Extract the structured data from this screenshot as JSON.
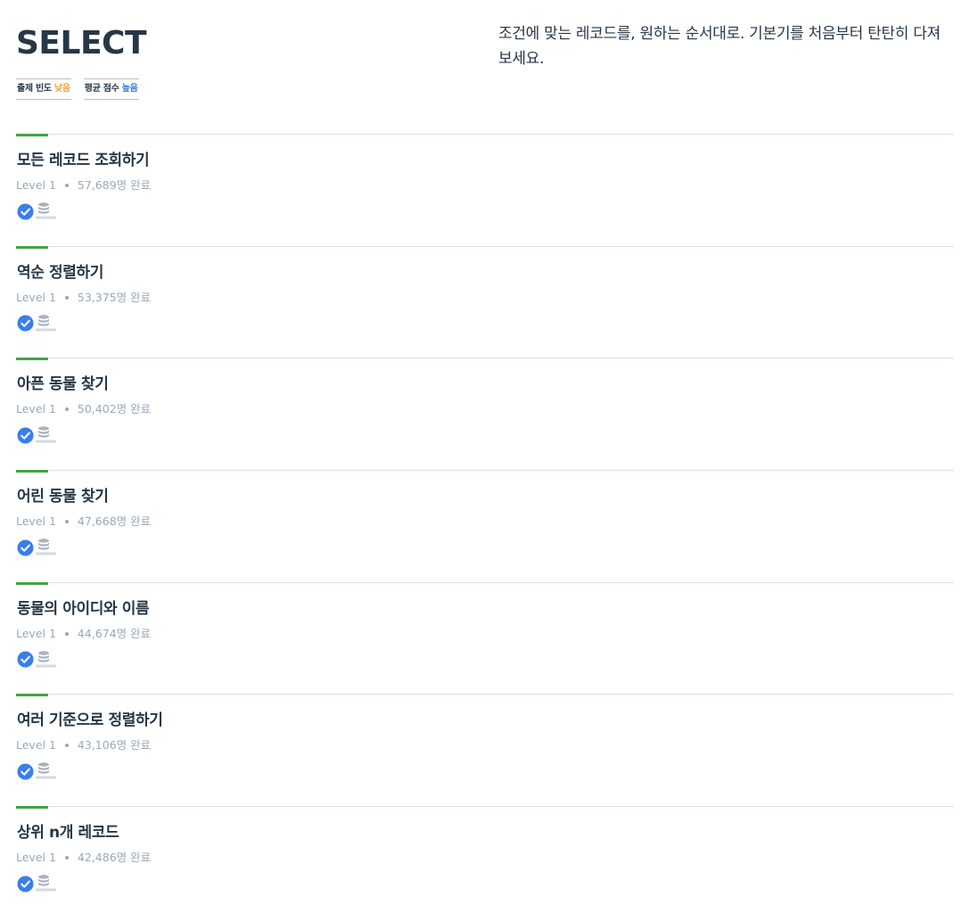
{
  "header": {
    "title": "SELECT",
    "tags": [
      {
        "label": "출제 빈도",
        "value": "낮음",
        "tone": "low"
      },
      {
        "label": "평균 점수",
        "value": "높음",
        "tone": "high"
      }
    ],
    "description": "조건에 맞는 레코드를, 원하는 순서대로. 기본기를 처음부터 탄탄히 다져보세요."
  },
  "colors": {
    "accent_green": "#44a340",
    "check_blue": "#3b7ee8",
    "frequency_low": "#f0a13a",
    "score_high": "#2e7be4"
  },
  "icons": {
    "solved": "check-circle-icon",
    "database": "oracle-database-icon"
  },
  "problems": [
    {
      "title": "모든 레코드 조회하기",
      "level": "Level 1",
      "completed": "57,689명 완료"
    },
    {
      "title": "역순 정렬하기",
      "level": "Level 1",
      "completed": "53,375명 완료"
    },
    {
      "title": "아픈 동물 찾기",
      "level": "Level 1",
      "completed": "50,402명 완료"
    },
    {
      "title": "어린 동물 찾기",
      "level": "Level 1",
      "completed": "47,668명 완료"
    },
    {
      "title": "동물의 아이디와 이름",
      "level": "Level 1",
      "completed": "44,674명 완료"
    },
    {
      "title": "여러 기준으로 정렬하기",
      "level": "Level 1",
      "completed": "43,106명 완료"
    },
    {
      "title": "상위 n개 레코드",
      "level": "Level 1",
      "completed": "42,486명 완료"
    }
  ]
}
